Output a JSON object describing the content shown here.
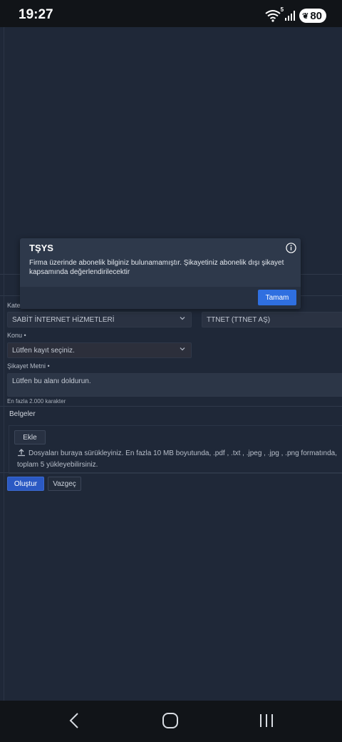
{
  "status_bar": {
    "time": "19:27",
    "wifi_badge": "5",
    "battery": "80"
  },
  "form": {
    "category_label": "Kate",
    "category_value": "SABİT İNTERNET HİZMETLERİ",
    "company_value": "TTNET (TTNET AŞ)",
    "subject_label": "Konu",
    "subject_placeholder": "Lütfen kayıt seçiniz.",
    "complaint_label": "Şikayet Metni",
    "complaint_placeholder": "Lütfen bu alanı doldurun.",
    "complaint_hint": "En fazla 2.000 karakter",
    "required_mark": "•",
    "documents_title": "Belgeler",
    "add_button": "Ekle",
    "upload_text": "Dosyaları buraya sürükleyiniz. En fazla 10 MB boyutunda, .pdf , .txt , .jpeg , .jpg , .png formatında, toplam 5 yükleyebilirsiniz.",
    "submit_button": "Oluştur",
    "cancel_button": "Vazgeç"
  },
  "dialog": {
    "title": "TŞYS",
    "message": "Firma üzerinde abonelik bilginiz bulunamamıştır. Şikayetiniz abonelik dışı şikayet kapsamında değerlendirilecektir",
    "ok_button": "Tamam",
    "icon": "info-icon"
  },
  "nav": {
    "back_icon": "back-icon",
    "home_icon": "home-icon",
    "recents_icon": "recents-icon"
  },
  "colors": {
    "background": "#1f2838",
    "primary": "#2f6fe0",
    "dialog": "#2e394b"
  }
}
